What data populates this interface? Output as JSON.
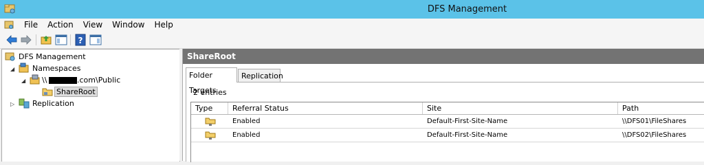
{
  "window": {
    "title": "DFS Management"
  },
  "menu": [
    "File",
    "Action",
    "View",
    "Window",
    "Help"
  ],
  "toolbar": {
    "icons": [
      "back-icon",
      "forward-icon",
      "up-folder-icon",
      "show-hide-console-tree-icon",
      "help-icon",
      "show-hide-action-pane-icon"
    ]
  },
  "tree": {
    "root": "DFS Management",
    "namespaces": "Namespaces",
    "namespace_prefix": "\\\\",
    "namespace_suffix": ".com\\Public",
    "shareroot": "ShareRoot",
    "replication": "Replication"
  },
  "panel": {
    "title": "ShareRoot",
    "tabs": [
      "Folder Targets",
      "Replication"
    ],
    "active_tab": "Folder Targets",
    "entries": "2 entries",
    "columns": [
      "Type",
      "Referral Status",
      "Site",
      "Path"
    ],
    "rows": [
      {
        "status": "Enabled",
        "site": "Default-First-Site-Name",
        "path": "\\\\DFS01\\FileShares"
      },
      {
        "status": "Enabled",
        "site": "Default-First-Site-Name",
        "path": "\\\\DFS02\\FileShares"
      }
    ]
  },
  "colors": {
    "titlebar": "#5bc2e8",
    "panel_header": "#737373"
  }
}
